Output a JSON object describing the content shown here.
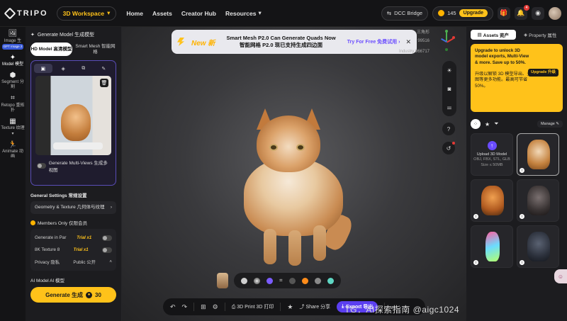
{
  "app": {
    "logo": "TRIPO",
    "workspace": "3D Workspace"
  },
  "nav": [
    {
      "label": "Home"
    },
    {
      "label": "Assets"
    },
    {
      "label": "Creator Hub"
    },
    {
      "label": "Resources"
    }
  ],
  "topright": {
    "dcc": "DCC Bridge",
    "credits": "145",
    "upgrade": "Upgrade",
    "notif_count": "4"
  },
  "rail": [
    {
      "label": "Image 生",
      "tag": "GPT Image 2"
    },
    {
      "label": "Model 模型"
    },
    {
      "label": "Segment 分割"
    },
    {
      "label": "Retopo 重拓扑"
    },
    {
      "label": "Texture 纹理"
    },
    {
      "label": "Animate 动画"
    }
  ],
  "panel": {
    "title": "Generate Model 生成模型",
    "mode_hd": "HD Model 高清模型",
    "mode_smart": "Smart Mesh 智能网格",
    "multiview": "Generate Multi-Views 生成多视图",
    "general_settings": "General Settings 常规设置",
    "geometry_texture": "Geometry & Texture 几何体与纹理",
    "members_only": "Members Only 仅限会员",
    "gen_in_parts": "Generate in Par",
    "texture_8k": "8K Texture 8",
    "privacy": "Privacy 隐私",
    "privacy_value": "Public 公开",
    "trial": "Trial x1",
    "ai_model": "AI Model AI 模型",
    "generate": "Generate 生成",
    "generate_cost": "30"
  },
  "banner": {
    "new": "New 新",
    "line1": "Smart Mesh P2.0 Can Generate Quads Now",
    "line2": "智能网格 P2.0 现已支持生成四边面",
    "try": "Try For Free 免费试用",
    "faint1": "三角形",
    "faint2": "99516",
    "faint3": "Industry 966717"
  },
  "bottom": {
    "print": "3D Print 3D 打印",
    "share": "Share 分享",
    "export": "Export 导出"
  },
  "watermark": "TG：AI探索指南 @aigc1024",
  "rpanel": {
    "tab_assets": "Assets 资产",
    "tab_property": "Property 属性",
    "promo_en": "Upgrade to unlock 3D model exports, Multi-View & more. Save up to 50%.",
    "promo_zh": "升级以解锁 3D 模型导出、多视图等更多功能。最高可节省 50%。",
    "promo_btn": "Upgrade 升级",
    "manage": "Manage",
    "upload_label": "Upload 3D Model",
    "upload_formats": "OBJ, FBX, STL, GLB",
    "upload_size": "Size ≤ 50MB"
  },
  "colors": {
    "accent": "#ffc21a",
    "purple": "#5b3ff0"
  }
}
